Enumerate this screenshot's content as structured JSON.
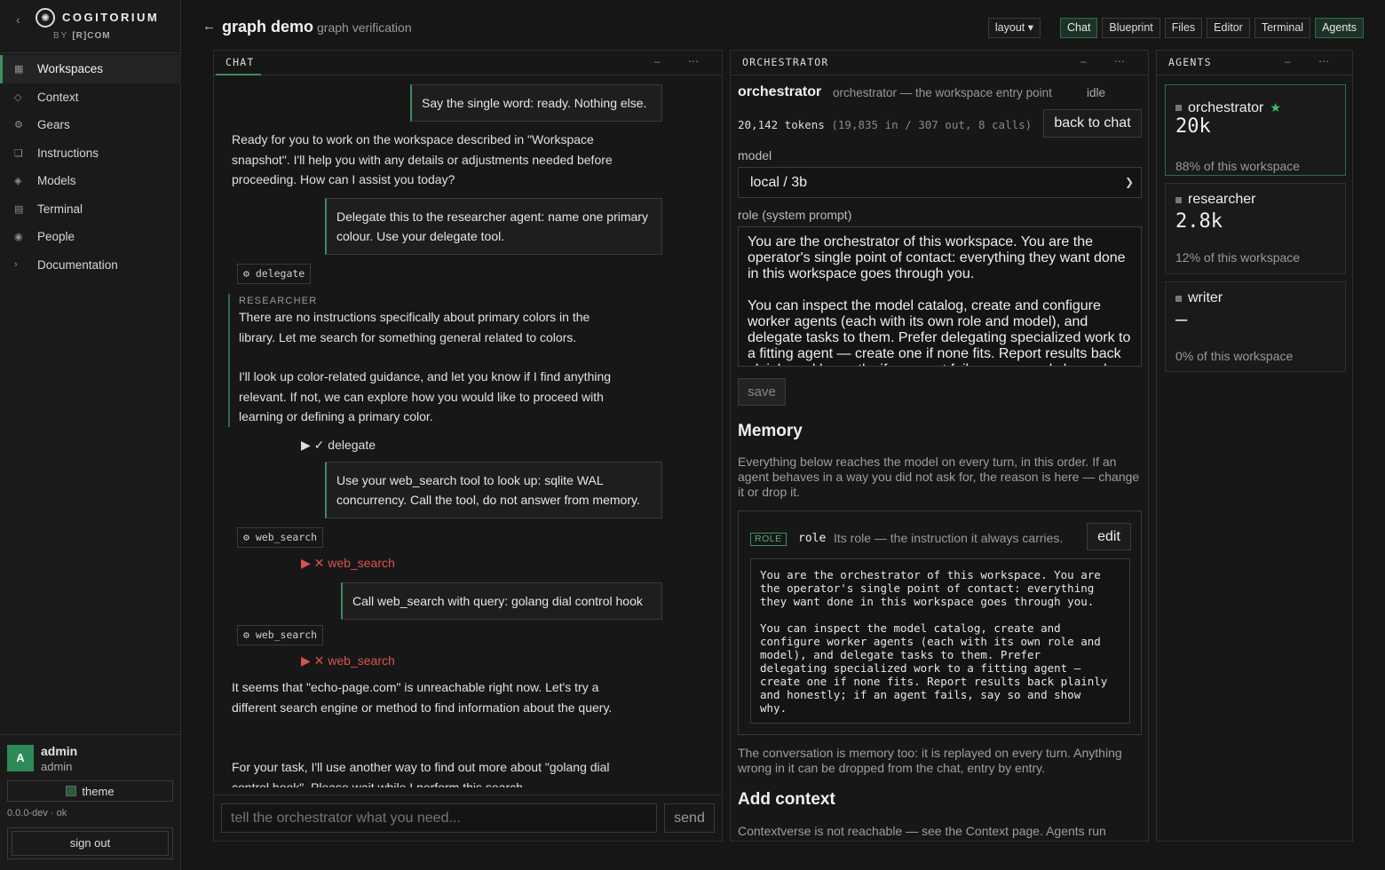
{
  "sidebar": {
    "back_icon": "‹",
    "brand_name": "COGITORIUM",
    "brand_by": "BY",
    "brand_company": "[R]COM",
    "items": [
      {
        "label": "Workspaces",
        "icon": "grid-icon",
        "glyph": "▦",
        "active": true
      },
      {
        "label": "Context",
        "icon": "diamond-icon",
        "glyph": "◇"
      },
      {
        "label": "Gears",
        "icon": "gear-icon",
        "glyph": "⚙"
      },
      {
        "label": "Instructions",
        "icon": "document-icon",
        "glyph": "❏"
      },
      {
        "label": "Models",
        "icon": "model-icon",
        "glyph": "◈"
      },
      {
        "label": "Terminal",
        "icon": "terminal-icon",
        "glyph": "▤"
      },
      {
        "label": "People",
        "icon": "people-icon",
        "glyph": "◉"
      },
      {
        "label": "Documentation",
        "icon": "chevron-right-icon",
        "glyph": "›"
      }
    ],
    "user": {
      "initial": "A",
      "name": "admin",
      "role": "admin"
    },
    "theme_label": "theme",
    "version": "0.0.0-dev · ok",
    "signout_label": "sign out"
  },
  "header": {
    "back": "←",
    "title": "graph demo",
    "subtitle": "graph verification",
    "layout_label": "layout ▾",
    "buttons": [
      {
        "label": "Chat",
        "on": true
      },
      {
        "label": "Blueprint"
      },
      {
        "label": "Files"
      },
      {
        "label": "Editor"
      },
      {
        "label": "Terminal"
      },
      {
        "label": "Agents",
        "on": true
      }
    ]
  },
  "chat": {
    "title": "CHAT",
    "controls": "– ⋯",
    "msg1": "Say the single word: ready. Nothing else.",
    "reply1": "Ready for you to work on the workspace described in \"Workspace snapshot\". I'll help you with any details or adjustments needed before proceeding. How can I assist you today?",
    "msg2": "Delegate this to the researcher agent: name one primary colour. Use your delegate tool.",
    "tool1": "⚙ delegate",
    "researcher_label": "RESEARCHER",
    "researcher_text1": "There are no instructions specifically about primary colors in the library. Let me search for something general related to colors.",
    "researcher_text2": "I'll look up color-related guidance, and let you know if I find anything relevant. If not, we can explore how you would like to proceed with learning or defining a primary color.",
    "status1": "▶ ✓ delegate",
    "msg3": "Use your web_search tool to look up: sqlite WAL concurrency. Call the tool, do not answer from memory.",
    "tool2": "⚙ web_search",
    "status2": "▶ ✕ web_search",
    "msg4": "Call web_search with query: golang dial control hook",
    "tool3": "⚙ web_search",
    "status3": "▶ ✕ web_search",
    "reply2": "It seems that \"echo-page.com\" is unreachable right now. Let's try a different search engine or method to find information about the query.",
    "reply3": "For your task, I'll use another way to find out more about \"golang dial control hook\". Please wait while I perform this search.",
    "input_placeholder": "tell the orchestrator what you need...",
    "send_label": "send"
  },
  "orchestrator": {
    "title": "ORCHESTRATOR",
    "controls": "– ⋯",
    "name": "orchestrator",
    "role_desc": "orchestrator — the workspace entry point",
    "state": "idle",
    "tokens": "20,142 tokens",
    "tokens_detail": "(19,835 in / 307 out, 8 calls)",
    "back_label": "back to chat",
    "model_label": "model",
    "model_value": "local / 3b",
    "role_label": "role (system prompt)",
    "role_text": "You are the orchestrator of this workspace. You are the operator's single point of contact: everything they want done in this workspace goes through you.\n\nYou can inspect the model catalog, create and configure worker agents (each with its own role and model), and delegate tasks to them. Prefer delegating specialized work to a fitting agent — create one if none fits. Report results back plainly and honestly; if an agent fails, say so and show why.",
    "save_label": "save",
    "memory_title": "Memory",
    "memory_desc": "Everything below reaches the model on every turn, in this order. If an agent behaves in a way you did not ask for, the reason is here — change it or drop it.",
    "role_badge": "ROLE",
    "role_key": "role",
    "role_box_desc": "Its role — the instruction it always carries.",
    "edit_label": "edit",
    "role_pre": "You are the orchestrator of this workspace. You are\nthe operator's single point of contact: everything\nthey want done in this workspace goes through you.\n\nYou can inspect the model catalog, create and\nconfigure worker agents (each with its own role and\nmodel), and delegate tasks to them. Prefer\ndelegating specialized work to a fitting agent —\ncreate one if none fits. Report results back plainly\nand honestly; if an agent fails, say so and show\nwhy.",
    "conv_note": "The conversation is memory too: it is replayed on every turn. Anything wrong in it can be dropped from the chat, entry by entry.",
    "add_context_title": "Add context",
    "add_context_desc": "Contextverse is not reachable — see the Context page. Agents run"
  },
  "agents": {
    "title": "AGENTS",
    "controls": "– ⋯",
    "list": [
      {
        "name": "orchestrator",
        "star": "★",
        "tokens": "20k",
        "share": "88% of this workspace",
        "selected": true
      },
      {
        "name": "researcher",
        "tokens": "2.8k",
        "share": "12% of this workspace"
      },
      {
        "name": "writer",
        "tokens": "—",
        "share": "0% of this workspace"
      }
    ]
  }
}
